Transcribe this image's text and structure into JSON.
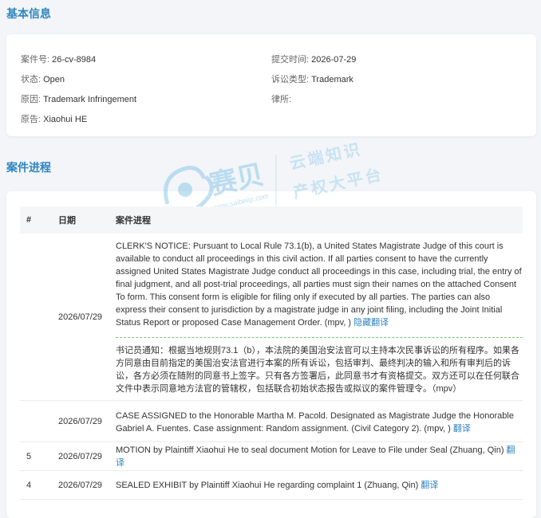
{
  "basic_info": {
    "title": "基本信息",
    "case_no_label": "案件号:",
    "case_no": "26-cv-8984",
    "filed_label": "提交时间:",
    "filed": "2026-07-29",
    "status_label": "状态:",
    "status": "Open",
    "type_label": "诉讼类型:",
    "type": "Trademark",
    "cause_label": "原因:",
    "cause": "Trademark Infringement",
    "firm_label": "律所:",
    "firm": "",
    "plaintiff_label": "原告:",
    "plaintiff": "Xiaohui HE"
  },
  "watermark": {
    "brand": "赛贝",
    "line1": "云端知识",
    "line2": "产权大平台",
    "url": "www.saibeiip.com"
  },
  "progress": {
    "title": "案件进程",
    "headers": {
      "num": "#",
      "date": "日期",
      "content": "案件进程"
    },
    "rows": [
      {
        "num": "",
        "date": "2026/07/29",
        "en": "CLERK'S NOTICE: Pursuant to Local Rule 73.1(b), a United States Magistrate Judge of this court is available to conduct all proceedings in this civil action. If all parties consent to have the currently assigned United States Magistrate Judge conduct all proceedings in this case, including trial, the entry of final judgment, and all post-trial proceedings, all parties must sign their names on the attached Consent To form. This consent form is eligible for filing only if executed by all parties. The parties can also express their consent to jurisdiction by a magistrate judge in any joint filing, including the Joint Initial Status Report or proposed Case Management Order. (mpv, )",
        "action": "隐藏翻译",
        "zh": "书记员通知：根据当地规则73.1（b），本法院的美国治安法官可以主持本次民事诉讼的所有程序。如果各方同意由目前指定的美国治安法官进行本案的所有诉讼，包括审判、最终判决的输入和所有审判后的诉讼，各方必须在随附的同意书上签字。只有各方签署后，此同意书才有资格提交。双方还可以在任何联合文件中表示同意地方法官的管辖权，包括联合初始状态报告或拟议的案件管理令。（mpv）"
      },
      {
        "num": "",
        "date": "2026/07/29",
        "en": "CASE ASSIGNED to the Honorable Martha M. Pacold. Designated as Magistrate Judge the Honorable Gabriel A. Fuentes. Case assignment: Random assignment. (Civil Category 2). (mpv, )",
        "action": "翻译"
      },
      {
        "num": "5",
        "date": "2026/07/29",
        "en": "MOTION by Plaintiff Xiaohui He to seal document Motion for Leave to File under Seal (Zhuang, Qin)",
        "action": "翻译"
      },
      {
        "num": "4",
        "date": "2026/07/29",
        "en": "SEALED EXHIBIT by Plaintiff Xiaohui He regarding complaint 1 (Zhuang, Qin)",
        "action": "翻译"
      }
    ]
  }
}
